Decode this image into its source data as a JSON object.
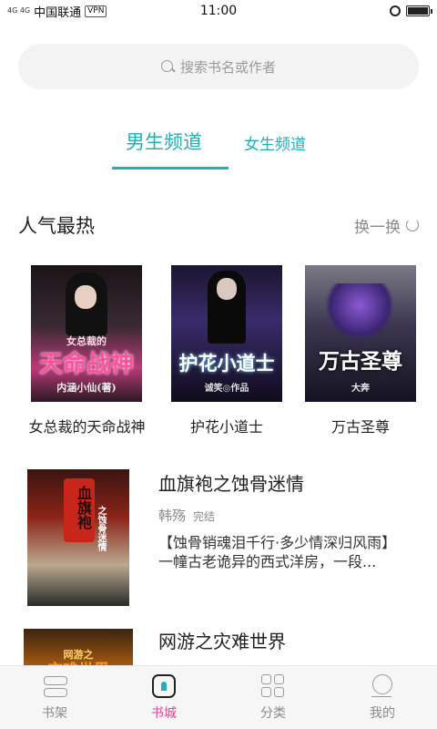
{
  "status_bar": {
    "network": "4G 4G",
    "carrier": "中国联通",
    "vpn": "VPN",
    "time": "11:00"
  },
  "search": {
    "placeholder": "搜索书名或作者"
  },
  "tabs": [
    {
      "label": "男生频道",
      "selected": true
    },
    {
      "label": "女生频道",
      "selected": false
    }
  ],
  "popular": {
    "title": "人气最热",
    "refresh_label": "换一换",
    "books": [
      {
        "name": "女总裁的天命战神",
        "cover_title": "天命战神",
        "cover_top": "女总裁的",
        "cover_author": "内涵小仙(著)"
      },
      {
        "name": "护花小道士",
        "cover_title": "护花小道士",
        "cover_author": "诚笑◎作品"
      },
      {
        "name": "万古圣尊",
        "cover_title": "万古圣尊",
        "cover_author": "大奔"
      }
    ]
  },
  "list": [
    {
      "title": "血旗袍之蚀骨迷情",
      "author": "韩殇",
      "status": "完结",
      "desc": "【蚀骨销魂泪千行·多少情深归风雨】\n一幢古老诡异的西式洋房，一段...",
      "cover_text": "血旗袍",
      "cover_sub": "之蚀骨迷情"
    },
    {
      "title": "网游之灾难世界",
      "cover_text": "灾难世界",
      "cover_sub": "网游之"
    }
  ],
  "bottom_nav": [
    {
      "label": "书架",
      "icon": "bookshelf-icon",
      "active": false
    },
    {
      "label": "书城",
      "icon": "bookstore-icon",
      "active": true
    },
    {
      "label": "分类",
      "icon": "category-icon",
      "active": false
    },
    {
      "label": "我的",
      "icon": "profile-icon",
      "active": false
    }
  ],
  "colors": {
    "accent": "#1fb1b8",
    "nav_active": "#e2458f"
  }
}
